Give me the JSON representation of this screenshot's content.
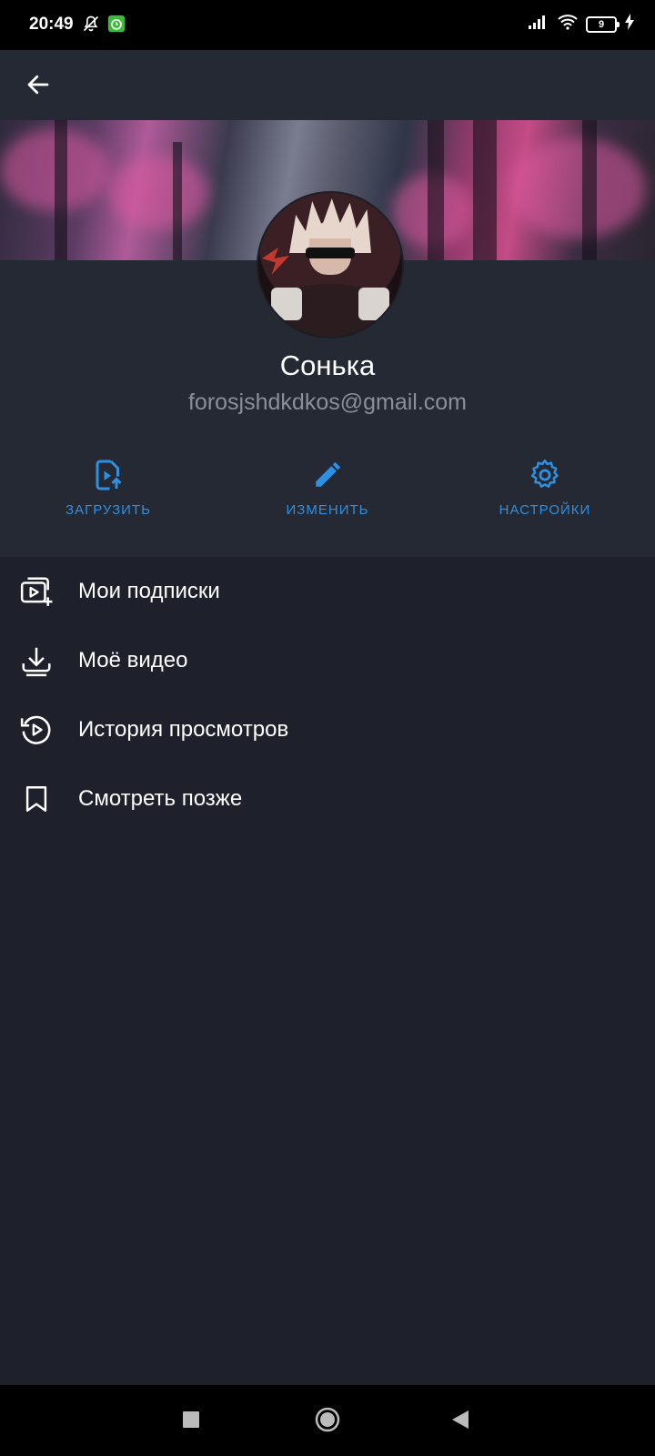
{
  "status_bar": {
    "time": "20:49",
    "battery_level": "9",
    "icons": [
      "bell-off-icon",
      "alarm-icon",
      "signal-icon",
      "wifi-icon",
      "battery-icon",
      "charging-icon"
    ]
  },
  "header": {
    "back_icon": "arrow-back-icon"
  },
  "profile": {
    "name": "Сонька",
    "email": "forosjshdkdkos@gmail.com"
  },
  "actions": [
    {
      "label": "ЗАГРУЗИТЬ",
      "icon": "upload-video-icon"
    },
    {
      "label": "ИЗМЕНИТЬ",
      "icon": "pencil-icon"
    },
    {
      "label": "НАСТРОЙКИ",
      "icon": "gear-icon"
    }
  ],
  "menu": [
    {
      "label": "Мои подписки",
      "icon": "subscriptions-icon"
    },
    {
      "label": "Моё видео",
      "icon": "download-icon"
    },
    {
      "label": "История просмотров",
      "icon": "history-icon"
    },
    {
      "label": "Смотреть позже",
      "icon": "bookmark-icon"
    }
  ],
  "colors": {
    "accent": "#2f8fe0",
    "background": "#1e202b",
    "header_bg": "#252934",
    "email_text": "#8c8f99"
  },
  "nav_bar": [
    "recents-button",
    "home-button",
    "back-button"
  ]
}
